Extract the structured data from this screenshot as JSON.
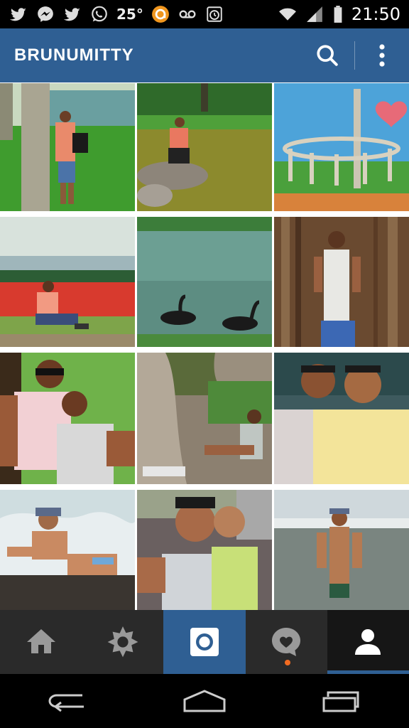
{
  "status_bar": {
    "temperature": "25°",
    "time": "21:50",
    "icons": [
      "twitter-icon",
      "messenger-icon",
      "twitter-icon",
      "whatsapp-icon",
      "app-notification-icon",
      "voicemail-icon",
      "alarm-icon",
      "wifi-icon",
      "signal-icon",
      "battery-icon"
    ]
  },
  "header": {
    "title": "BRUNUMITTY",
    "search_icon": "search-icon",
    "menu_icon": "overflow-menu-icon"
  },
  "photos": [
    {
      "subject": "man with backpack under tree on lawn"
    },
    {
      "subject": "man crouching on rock by pond"
    },
    {
      "subject": "circular monument with tall pillar"
    },
    {
      "subject": "man sitting by red flower bed and lake"
    },
    {
      "subject": "two black swans on lake"
    },
    {
      "subject": "man in tank top in front of tree roots"
    },
    {
      "subject": "two men lying on grass selfie"
    },
    {
      "subject": "man sitting under large tree"
    },
    {
      "subject": "two men selfie indoors"
    },
    {
      "subject": "man with cap lying on beach rocks"
    },
    {
      "subject": "two men selfie outdoors"
    },
    {
      "subject": "man in swimsuit at the beach"
    }
  ],
  "tabs": [
    {
      "name": "home",
      "icon": "home-icon"
    },
    {
      "name": "explore",
      "icon": "explore-star-icon"
    },
    {
      "name": "camera",
      "icon": "camera-icon"
    },
    {
      "name": "news",
      "icon": "activity-heart-icon"
    },
    {
      "name": "profile",
      "icon": "profile-icon"
    }
  ],
  "colors": {
    "brand_blue": "#2f5f93",
    "tab_bar": "#2a2a2a",
    "notification_dot": "#f26b21"
  },
  "nav": [
    "back-icon",
    "home-nav-icon",
    "recent-apps-icon"
  ]
}
